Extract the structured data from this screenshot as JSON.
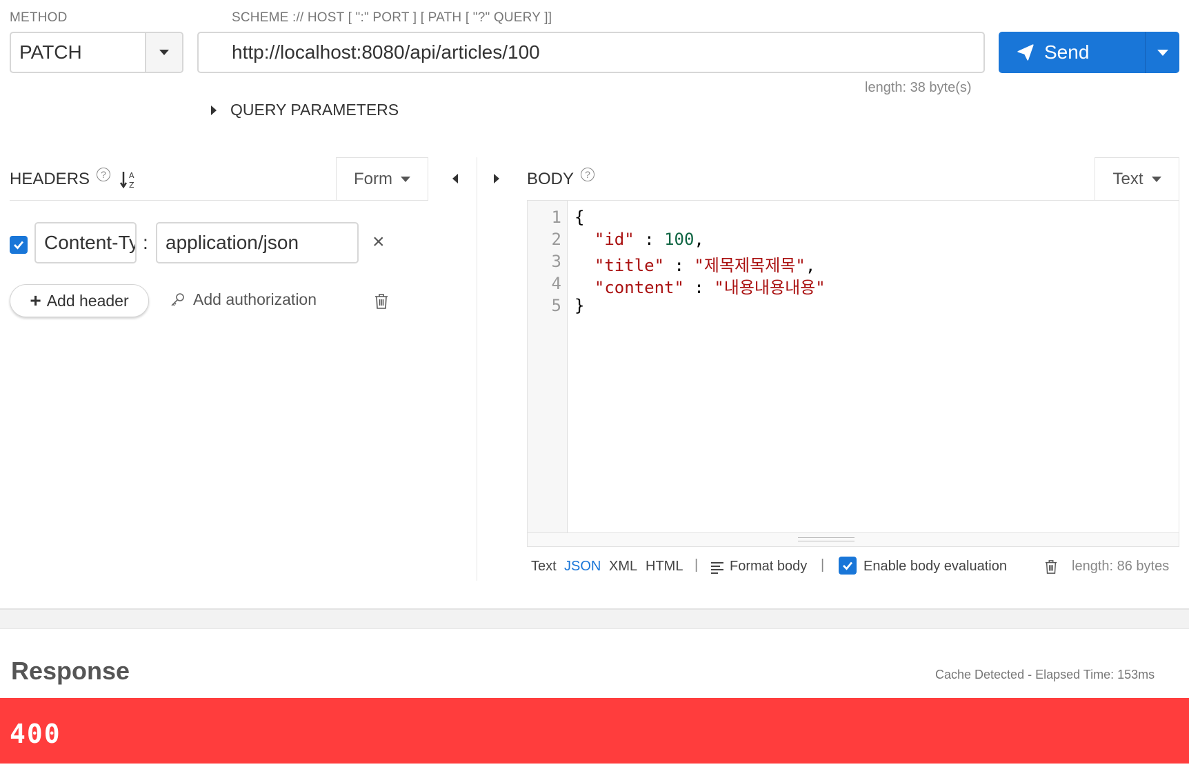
{
  "request": {
    "method_label": "METHOD",
    "method": "PATCH",
    "url_label": "SCHEME :// HOST [ \":\" PORT ] [ PATH [ \"?\" QUERY ]]",
    "url": "http://localhost:8080/api/articles/100",
    "url_length": "length: 38 byte(s)",
    "send_label": "Send",
    "query_params_label": "QUERY PARAMETERS"
  },
  "headers": {
    "title": "HEADERS",
    "mode": "Form",
    "items": [
      {
        "enabled": true,
        "key": "Content-Type",
        "value": "application/json"
      }
    ],
    "add_header_label": "Add header",
    "add_auth_label": "Add authorization"
  },
  "body": {
    "title": "BODY",
    "mode": "Text",
    "lines": [
      "1",
      "2",
      "3",
      "4",
      "5"
    ],
    "code": {
      "open": "{",
      "id_key": "\"id\"",
      "id_sep": " : ",
      "id_val": "100",
      "title_key": "\"title\"",
      "title_sep": " : ",
      "title_val": "\"제목제목제목\"",
      "content_key": "\"content\"",
      "content_sep": " : ",
      "content_val": "\"내용내용내용\"",
      "close": "}"
    },
    "formats": [
      "Text",
      "JSON",
      "XML",
      "HTML"
    ],
    "active_format": "JSON",
    "format_body_label": "Format body",
    "enable_eval_label": "Enable body evaluation",
    "length": "length: 86 bytes"
  },
  "response": {
    "title": "Response",
    "meta": "Cache Detected - Elapsed Time: 153ms",
    "status": "400",
    "status_color": "#ff3d3d"
  },
  "colors": {
    "accent": "#1976d8"
  }
}
